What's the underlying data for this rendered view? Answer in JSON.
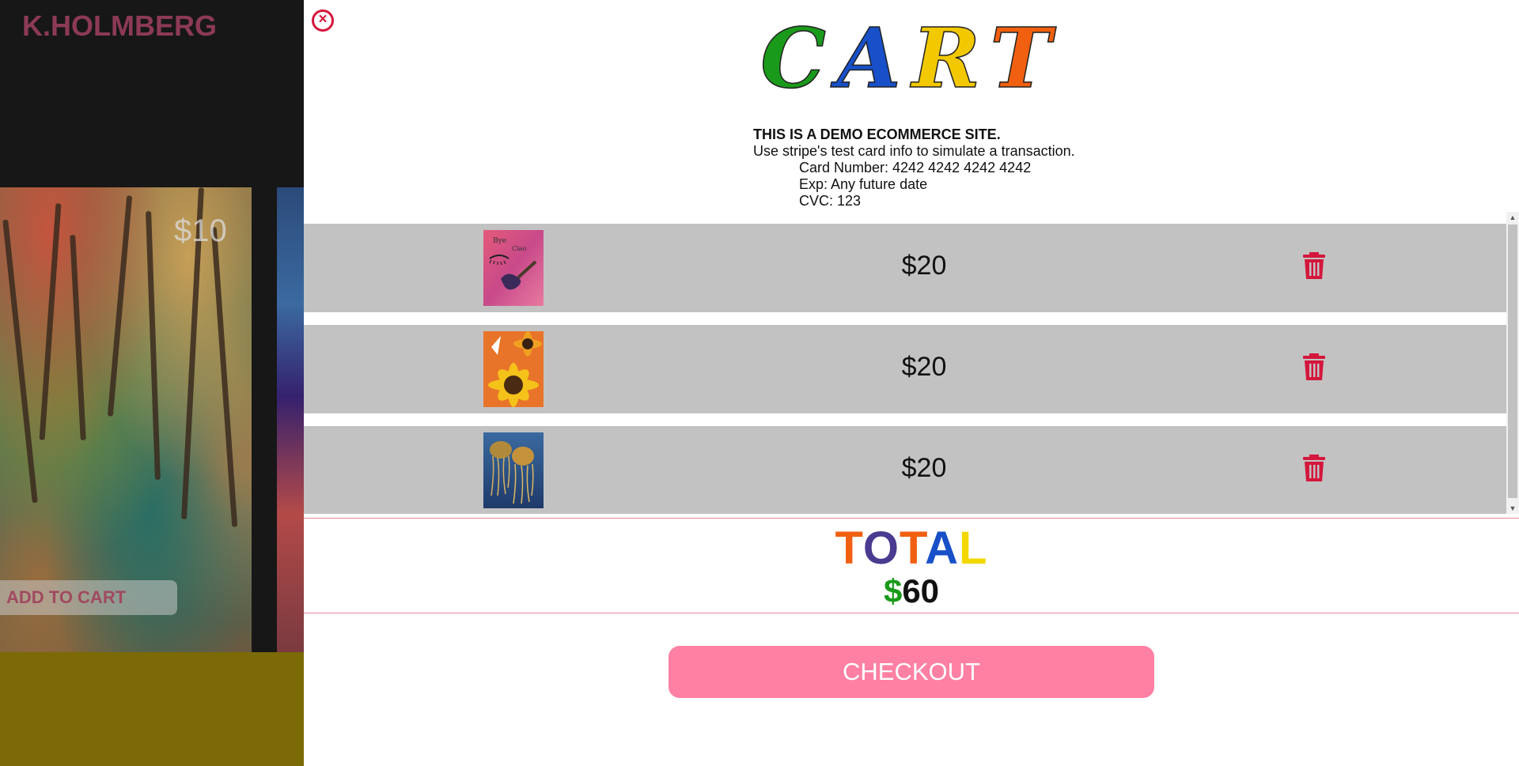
{
  "background": {
    "brand": "K.HOLMBERG",
    "product_price": "$10",
    "add_to_cart_label": "ADD TO CART"
  },
  "cart": {
    "close_icon": "close-circle-icon",
    "title_letters": [
      {
        "char": "C",
        "color": "#1a9a1a"
      },
      {
        "char": "A",
        "color": "#1750c8"
      },
      {
        "char": "R",
        "color": "#f2c800"
      },
      {
        "char": "T",
        "color": "#f06010"
      }
    ],
    "demo_notice": {
      "heading": "THIS IS A DEMO ECOMMERCE SITE.",
      "line1": "Use stripe's test card info to simulate a transaction.",
      "card_number": "Card Number: 4242 4242 4242 4242",
      "exp": "Exp: Any future date",
      "cvc": "CVC: 123"
    },
    "items": [
      {
        "price": "$20",
        "thumbnail": "painting-lips-pipe",
        "delete_icon": "trash-icon"
      },
      {
        "price": "$20",
        "thumbnail": "painting-sunflowers",
        "delete_icon": "trash-icon"
      },
      {
        "price": "$20",
        "thumbnail": "painting-jellyfish",
        "delete_icon": "trash-icon"
      }
    ],
    "total_letters": [
      {
        "char": "T",
        "color": "#f06010"
      },
      {
        "char": "O",
        "color": "#4a3a90"
      },
      {
        "char": "T",
        "color": "#f06010"
      },
      {
        "char": "A",
        "color": "#1750c8"
      },
      {
        "char": "L",
        "color": "#f2d800"
      }
    ],
    "total_currency": "$",
    "total_value": "60",
    "checkout_label": "CHECKOUT"
  },
  "colors": {
    "accent_pink": "#ff80a3",
    "danger_red": "#d4173c",
    "row_gray": "#c2c2c2"
  }
}
